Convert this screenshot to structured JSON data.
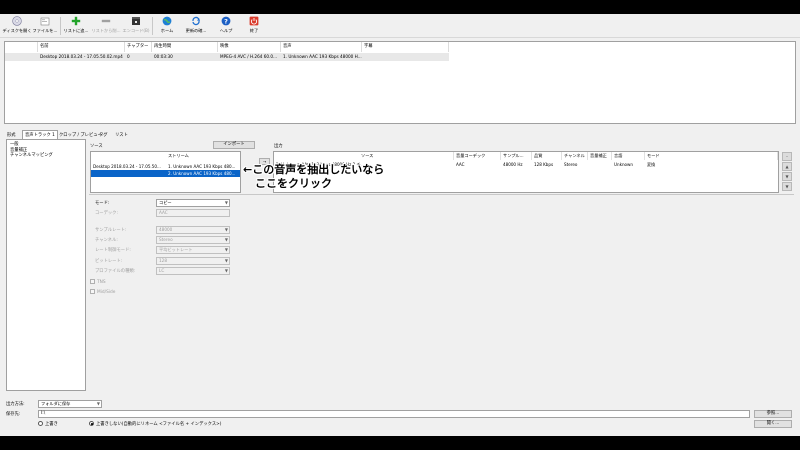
{
  "toolbar": {
    "buttons": [
      {
        "label": "ディスクを開く",
        "icon": "disc-icon",
        "enabled": true
      },
      {
        "label": "ファイルを...",
        "icon": "folder-icon",
        "enabled": true
      },
      {
        "label": "リストに追...",
        "icon": "plus-icon",
        "enabled": true
      },
      {
        "label": "リストから削...",
        "icon": "minus-icon",
        "enabled": false
      },
      {
        "label": "エンコード(B)",
        "icon": "clapper-icon",
        "enabled": false
      },
      {
        "label": "ホーム",
        "icon": "globe-icon",
        "enabled": true
      },
      {
        "label": "更新の確...",
        "icon": "refresh-icon",
        "enabled": true
      },
      {
        "label": "ヘルプ",
        "icon": "help-icon",
        "enabled": true
      },
      {
        "label": "終了",
        "icon": "power-icon",
        "enabled": true
      }
    ]
  },
  "file_list": {
    "columns": [
      "名前",
      "チャプター",
      "再生時間",
      "映像",
      "音声",
      "字幕"
    ],
    "rows": [
      {
        "name": "Desktop 2018.03.24 - 17.05.50.02.mp4",
        "chapters": "0",
        "duration": "00:03:30",
        "video": "MPEG-4 AVC / H.264 60.0...",
        "audio": "1. Unknown AAC 193 Kbps 48000 H...",
        "subtitle": ""
      }
    ]
  },
  "tabs": [
    "形式",
    "音声トラック 1",
    "クロップ / プレビュー",
    "タグ",
    "リスト"
  ],
  "left_panel": {
    "items": [
      "一般",
      "音量補正",
      "チャンネルマッピング"
    ]
  },
  "source": {
    "label": "ソース",
    "import_label": "インポート",
    "stream_header": "ストリーム",
    "rows": [
      {
        "file": "Desktop 2018.03.24 - 17.05.50...",
        "stream": "1. Unknown AAC 193 Kbps 480..."
      },
      {
        "file": "",
        "stream": "2. Unknown AAC 193 Kbps 480..."
      }
    ],
    "move_label": "→"
  },
  "output": {
    "label": "出力",
    "columns": [
      "ソース",
      "音量コーデック",
      "サンプル...",
      "品質",
      "チャンネル",
      "音量補正",
      "言語",
      "モード"
    ],
    "row": [
      "2. Unknown AAC 193 Kbps 48000 Hz 2 チ...",
      "AAC",
      "48000 Hz",
      "128 Kbps",
      "Stereo",
      "",
      "Unknown",
      "変換"
    ]
  },
  "annotation": {
    "line1": "←この音声を抽出したいなら",
    "line2": "ここをクリック"
  },
  "settings": {
    "fields": [
      {
        "label": "モード:",
        "value": "コピー",
        "enabled": true
      },
      {
        "label": "コーデック:",
        "value": "AAC",
        "enabled": false
      },
      {
        "label": "サンプルレート:",
        "value": "48000",
        "enabled": false
      },
      {
        "label": "チャンネル:",
        "value": "Stereo",
        "enabled": false
      },
      {
        "label": "レート制御モード:",
        "value": "平均ビットレート",
        "enabled": false
      },
      {
        "label": "ビットレート:",
        "value": "128",
        "enabled": false
      },
      {
        "label": "プロファイルの種類:",
        "value": "LC",
        "enabled": false
      }
    ],
    "checks": [
      "TNS",
      "Mid/Side"
    ]
  },
  "bottom": {
    "out_method_label": "出力方法:",
    "out_method_value": "フォルダに保存",
    "save_path_label": "保存先:",
    "save_path_value": "I:\\",
    "browse_label": "参照...",
    "open_label": "開く...",
    "radio_overwrite": "上書き",
    "radio_auto_rename": "上書きしない(自動的にリネーム <ファイル名 + インデックス>)"
  }
}
